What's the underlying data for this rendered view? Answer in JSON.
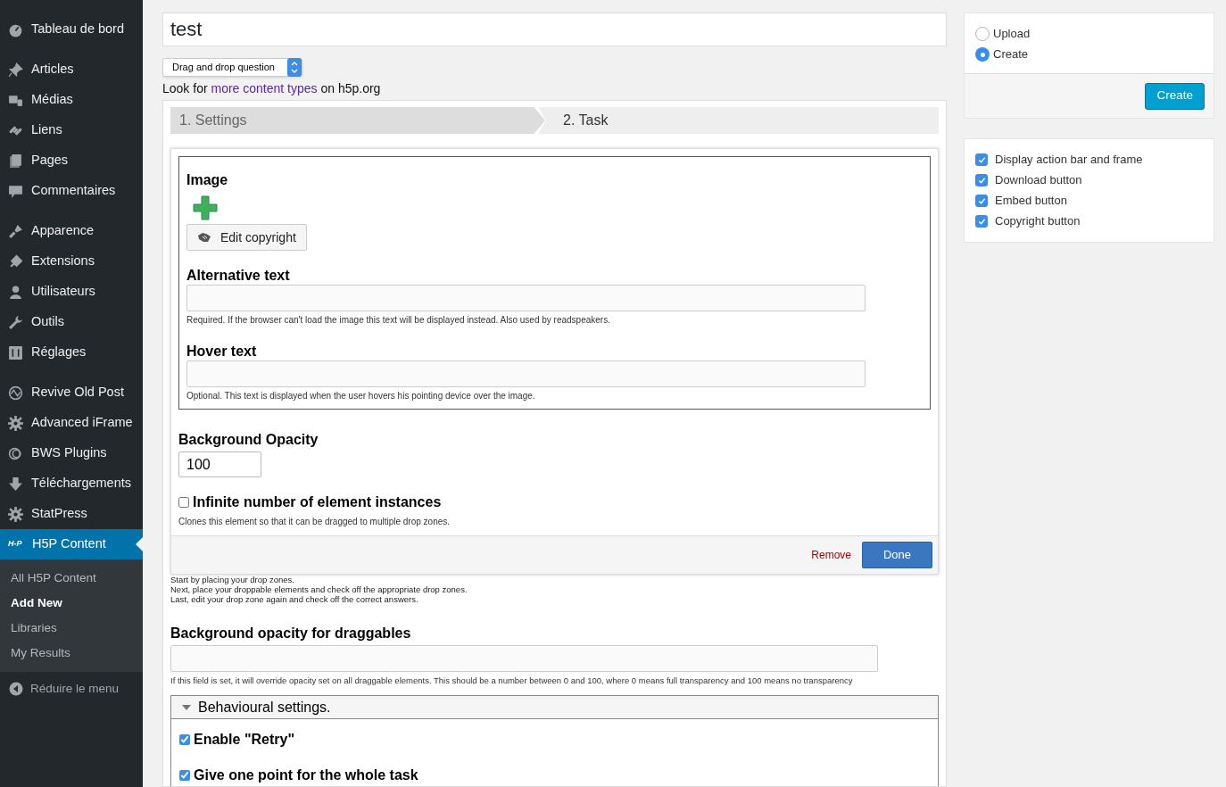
{
  "sidebar": {
    "groups": [
      [
        {
          "label": "Tableau de bord",
          "selected": false
        }
      ],
      [
        {
          "label": "Articles",
          "selected": false
        },
        {
          "label": "Médias",
          "selected": false
        },
        {
          "label": "Liens",
          "selected": false
        },
        {
          "label": "Pages",
          "selected": false
        },
        {
          "label": "Commentaires",
          "selected": false
        }
      ],
      [
        {
          "label": "Apparence",
          "selected": false
        },
        {
          "label": "Extensions",
          "selected": false
        },
        {
          "label": "Utilisateurs",
          "selected": false
        },
        {
          "label": "Outils",
          "selected": false
        },
        {
          "label": "Réglages",
          "selected": false
        }
      ],
      [
        {
          "label": "Revive Old Post",
          "selected": false
        },
        {
          "label": "Advanced iFrame",
          "selected": false
        },
        {
          "label": "BWS Plugins",
          "selected": false
        },
        {
          "label": "Téléchargements",
          "selected": false
        },
        {
          "label": "StatPress",
          "selected": false
        },
        {
          "label": "H5P Content",
          "selected": true,
          "badge": "H-P"
        }
      ]
    ],
    "submenu": [
      {
        "label": "All H5P Content",
        "selected": false
      },
      {
        "label": "Add New",
        "selected": true
      },
      {
        "label": "Libraries",
        "selected": false
      },
      {
        "label": "My Results",
        "selected": false
      }
    ],
    "collapse": "Réduire le menu"
  },
  "title_field": {
    "value": "test"
  },
  "content_type": {
    "value": "Drag and drop question"
  },
  "more_hint": {
    "prefix": "Look for",
    "link": "more content types",
    "suffix": "on h5p.org"
  },
  "steps": [
    {
      "label": "1. Settings",
      "selected": true
    },
    {
      "label": "2. Task",
      "selected": false
    }
  ],
  "element_editor": {
    "image_label": "Image",
    "copyright_button": "Edit copyright",
    "fields": [
      {
        "label": "Alternative text",
        "description": "Required. If the browser can't load the image this text will be displayed instead. Also used by readspeakers."
      },
      {
        "label": "Hover text",
        "description": "Optional. This text is displayed when the user hovers his pointing device over the image."
      }
    ],
    "opacity_label": "Background Opacity",
    "opacity_value": "100",
    "infinite": {
      "label": "Infinite number of element instances",
      "checked": false,
      "description": "Clones this element so that it can be dragged to multiple drop zones."
    },
    "remove": "Remove",
    "done": "Done"
  },
  "instructions": [
    "Start by placing your drop zones.",
    "Next, place your droppable elements and check off the appropriate drop zones.",
    "Last, edit your drop zone again and check off the correct answers."
  ],
  "draggable_opacity": {
    "label": "Background opacity for draggables",
    "description": "If this field is set, it will override opacity set on all draggable elements. This should be a number between 0 and 100, where 0 means full transparency and 100 means no transparency"
  },
  "behaviour": {
    "title": "Behavioural settings.",
    "expanded": true,
    "options": [
      {
        "label": "Enable \"Retry\"",
        "checked": true
      },
      {
        "label": "Give one point for the whole task",
        "checked": true
      }
    ]
  },
  "source": {
    "options": [
      {
        "label": "Upload",
        "selected": false
      },
      {
        "label": "Create",
        "selected": true
      }
    ],
    "button": "Create"
  },
  "display_options": [
    {
      "label": "Display action bar and frame",
      "checked": true
    },
    {
      "label": "Download button",
      "checked": true
    },
    {
      "label": "Embed button",
      "checked": true
    },
    {
      "label": "Copyright button",
      "checked": true
    }
  ]
}
